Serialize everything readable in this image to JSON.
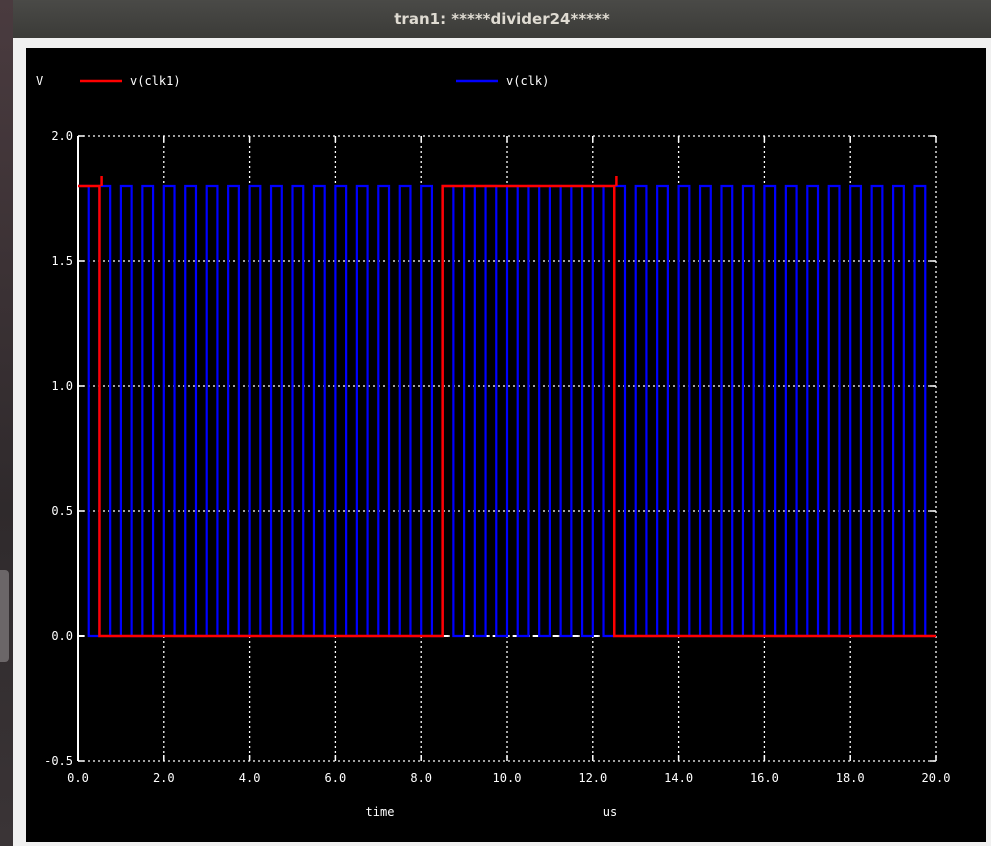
{
  "window": {
    "title": "tran1: *****divider24*****"
  },
  "chart_data": {
    "type": "line",
    "ylabel": "V",
    "xlabel": "time",
    "xunit": "us",
    "xlim": [
      0,
      20
    ],
    "ylim": [
      -0.5,
      2.0
    ],
    "x_ticks": [
      0,
      2,
      4,
      6,
      8,
      10,
      12,
      14,
      16,
      18,
      20
    ],
    "x_tick_labels": [
      "0.0",
      "2.0",
      "4.0",
      "6.0",
      "8.0",
      "10.0",
      "12.0",
      "14.0",
      "16.0",
      "18.0",
      "20.0"
    ],
    "y_ticks": [
      -0.5,
      0,
      0.5,
      1.0,
      1.5,
      2.0
    ],
    "y_tick_labels": [
      "-0.5",
      "0.0",
      "0.5",
      "1.0",
      "1.5",
      "2.0"
    ],
    "grid": true,
    "legend_position": "top",
    "colors": {
      "background": "#000000",
      "axes": "#ffffff",
      "clk1": "#ff0000",
      "clk": "#0000ff"
    },
    "series": [
      {
        "name": "v(clk1)",
        "color": "#ff0000",
        "description_points": "square wave high 1.8 V from 0 to 0.5 us, low until 8.5 us, high until 12.5 us, low to 20 us",
        "steps": [
          [
            0,
            1.8
          ],
          [
            0.5,
            0.0
          ],
          [
            8.5,
            1.8
          ],
          [
            12.5,
            0.0
          ],
          [
            20,
            0.0
          ]
        ]
      },
      {
        "name": "v(clk)",
        "color": "#0000ff",
        "period_us": 0.5,
        "high_v": 1.8,
        "low_v": 0.0,
        "start_us": 0,
        "end_us": 20
      }
    ]
  }
}
